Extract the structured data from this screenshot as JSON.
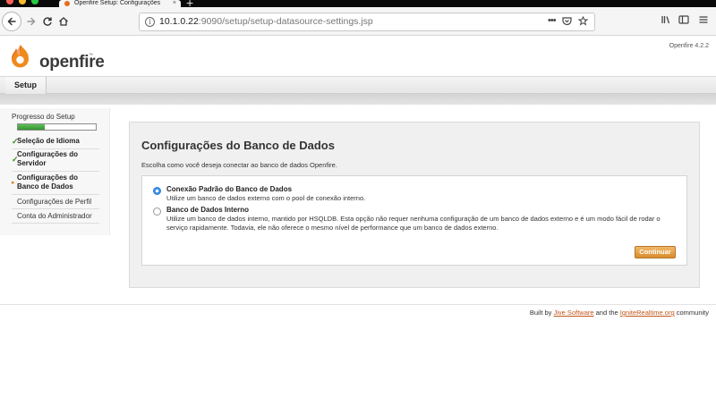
{
  "browser": {
    "tab_title": "Openfire Setup: Configurações",
    "tab_close": "×",
    "new_tab": "+",
    "url_host": "10.1.0.22",
    "url_rest": ":9090/setup/setup-datasource-settings.jsp",
    "url_menu": "•••"
  },
  "header": {
    "logo_text": "openfire",
    "logo_tm": "™",
    "version": "Openfire 4.2.2"
  },
  "menu": {
    "setup_tab": "Setup"
  },
  "sidebar": {
    "heading": "Progresso do Setup",
    "progress": 0.35,
    "items": [
      {
        "label": "Seleção de Idioma",
        "status": "done",
        "mark": "✓"
      },
      {
        "label": "Configurações do Servidor",
        "status": "done",
        "mark": "✓"
      },
      {
        "label": "Configurações do Banco de Dados",
        "status": "current",
        "mark": "▸"
      },
      {
        "label": "Configurações de Perfil",
        "status": "pending",
        "mark": ""
      },
      {
        "label": "Conta do Administrador",
        "status": "pending",
        "mark": ""
      }
    ]
  },
  "main": {
    "title": "Configurações do Banco de Dados",
    "description": "Escolha como você deseja conectar ao banco de dados Openfire.",
    "options": [
      {
        "title": "Conexão Padrão do Banco de Dados",
        "description": "Utilize um banco de dados externo com o pool de conexão interno.",
        "selected": true
      },
      {
        "title": "Banco de Dados Interno",
        "description": "Utilize um banco de dados interno, mantido por HSQLDB. Esta opção não requer nenhuma configuração de um banco de dados externo e é um modo fácil de rodar o serviço rapidamente. Todavia, ele não oferece o mesmo nível de performance que um banco de dados externo.",
        "selected": false
      }
    ],
    "continue_label": "Continuar"
  },
  "footer": {
    "prefix": "Built by",
    "link1": "Jive Software",
    "middle": "and the",
    "link2": "IgniteRealtime.org",
    "suffix": "community"
  },
  "colors": {
    "accent_orange": "#d98d2c",
    "progress_green": "#34922f",
    "link": "#c4561a"
  }
}
